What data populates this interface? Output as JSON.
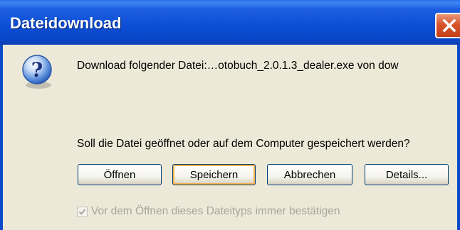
{
  "window": {
    "title": "Dateidownload",
    "close_icon": "close-icon"
  },
  "message": {
    "icon": "question-icon",
    "file_line": "Download folgender Datei:…otobuch_2.0.1.3_dealer.exe von dow",
    "prompt": "Soll die Datei geöffnet oder auf dem Computer gespeichert werden?"
  },
  "buttons": {
    "open": "Öffnen",
    "save": "Speichern",
    "cancel": "Abbrechen",
    "details": "Details..."
  },
  "confirm_checkbox": {
    "label": "Vor dem Öffnen dieses Dateityps immer bestätigen",
    "checked": true,
    "enabled": false
  },
  "colors": {
    "titlebar": "#0d4fd6",
    "dialog_bg": "#ece9d8",
    "close_button": "#d9532a",
    "default_button_focus": "#f8b34f"
  }
}
